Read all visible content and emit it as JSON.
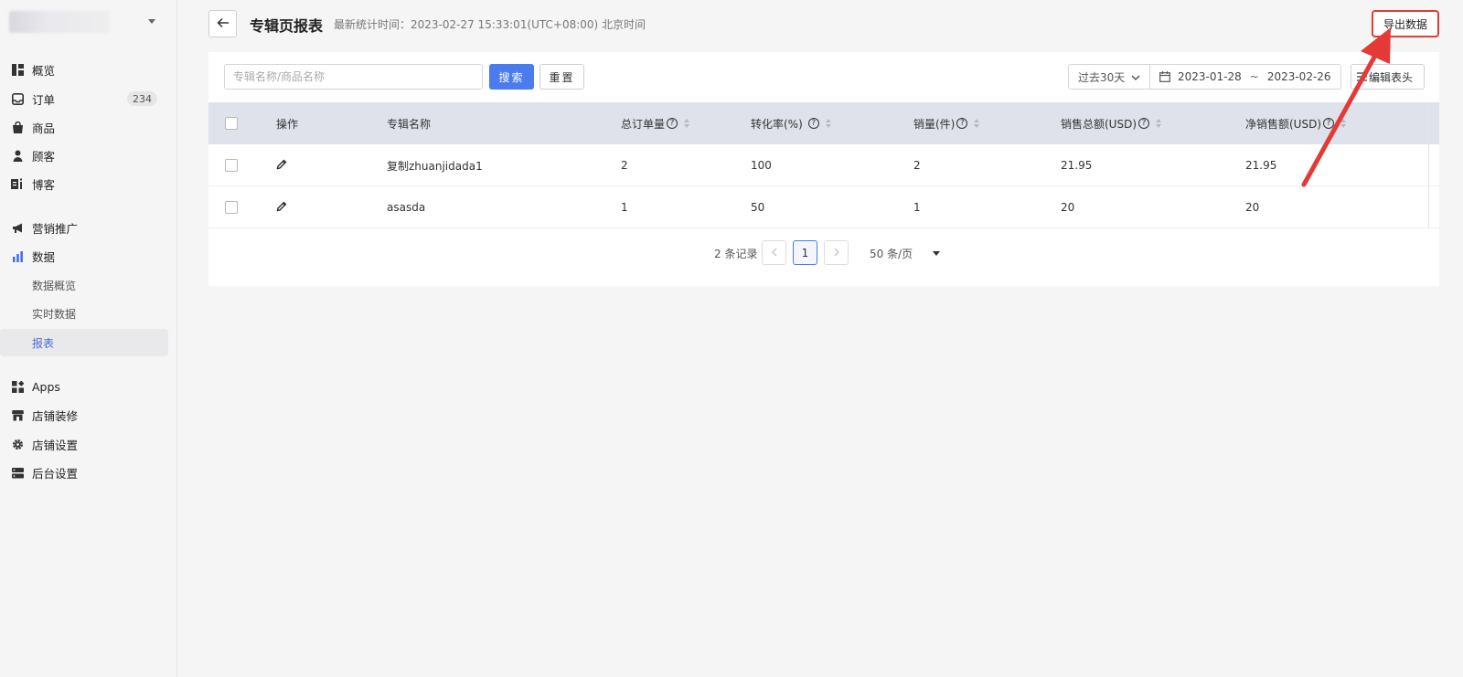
{
  "sidebar": {
    "store_name": "",
    "items": [
      {
        "label": "概览",
        "icon": "dashboard-icon"
      },
      {
        "label": "订单",
        "icon": "inbox-icon",
        "badge": "234"
      },
      {
        "label": "商品",
        "icon": "bag-icon"
      },
      {
        "label": "顾客",
        "icon": "person-icon"
      },
      {
        "label": "博客",
        "icon": "blog-icon"
      },
      {
        "label": "营销推广",
        "icon": "megaphone-icon"
      },
      {
        "label": "数据",
        "icon": "bar-chart-icon"
      },
      {
        "label": "Apps",
        "icon": "apps-icon"
      },
      {
        "label": "店铺装修",
        "icon": "store-icon"
      },
      {
        "label": "店铺设置",
        "icon": "gear-icon"
      },
      {
        "label": "后台设置",
        "icon": "server-icon"
      }
    ],
    "data_sub": [
      {
        "label": "数据概览"
      },
      {
        "label": "实时数据"
      },
      {
        "label": "报表",
        "active": true
      }
    ]
  },
  "header": {
    "title": "专辑页报表",
    "stat_time": "最新统计时间：2023-02-27 15:33:01(UTC+08:00) 北京时间",
    "export_label": "导出数据"
  },
  "filters": {
    "search_placeholder": "专辑名称/商品名称",
    "search_label": "搜索",
    "reset_label": "重置",
    "range_label": "过去30天",
    "date_start": "2023-01-28",
    "date_sep": "~",
    "date_end": "2023-02-26",
    "edit_header_label": "编辑表头"
  },
  "table": {
    "columns": [
      "操作",
      "专辑名称",
      "总订单量",
      "转化率(%)",
      "销量(件)",
      "销售总额(USD)",
      "净销售额(USD)"
    ],
    "rows": [
      {
        "name": "复制zhuanjidada1",
        "orders": "2",
        "conversion": "100",
        "sales": "2",
        "total": "21.95",
        "net": "21.95"
      },
      {
        "name": "asasda",
        "orders": "1",
        "conversion": "50",
        "sales": "1",
        "total": "20",
        "net": "20"
      }
    ]
  },
  "pagination": {
    "total_text": "2 条记录",
    "current_page": "1",
    "page_size": "50 条/页"
  },
  "colors": {
    "accent": "#4a7cf0",
    "annotation": "#e53935",
    "table_header_bg": "#dfe2ea"
  }
}
